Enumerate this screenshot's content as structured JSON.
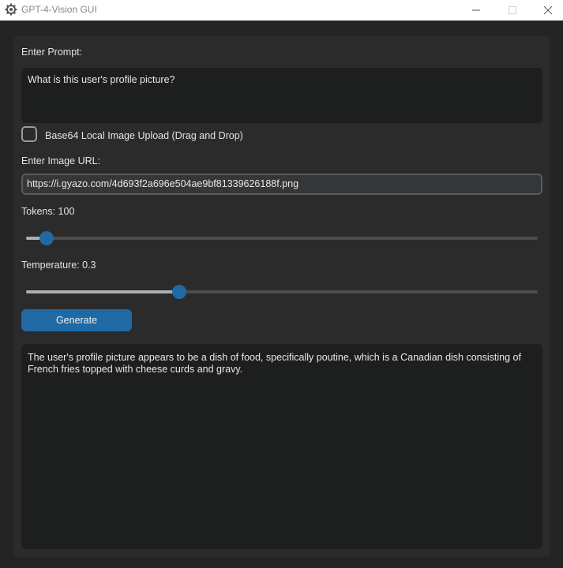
{
  "window": {
    "title": "GPT-4-Vision GUI",
    "icon": "gear-icon",
    "controls": [
      "minimize-icon",
      "maximize-icon",
      "close-icon"
    ]
  },
  "prompt": {
    "label": "Enter Prompt:",
    "value": "What is this user's profile picture?"
  },
  "upload": {
    "label": "Base64 Local Image Upload (Drag and Drop)",
    "checked": false
  },
  "image_url": {
    "label": "Enter Image URL:",
    "value": "https://i.gyazo.com/4d693f2a696e504ae9bf81339626188f.png"
  },
  "tokens": {
    "label": "Tokens: 100",
    "value": 100,
    "fraction": 0.04
  },
  "temperature": {
    "label": "Temperature: 0.3",
    "value": 0.3,
    "fraction": 0.3
  },
  "generate": {
    "label": "Generate"
  },
  "output": {
    "text": "The user's profile picture appears to be a dish of food, specifically poutine, which is a Canadian dish consisting of French fries topped with cheese curds and gravy."
  },
  "colors": {
    "accent": "#1f6aa5",
    "panel": "#2b2b2b",
    "background": "#242424",
    "textbox": "#1d1e1e"
  }
}
